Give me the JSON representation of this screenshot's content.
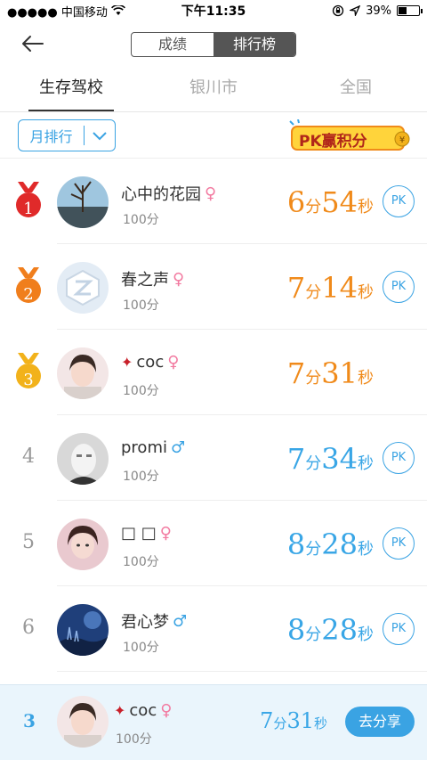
{
  "status_bar": {
    "carrier": "●●●●● 中国移动",
    "time": "下午11:35",
    "battery": "39%"
  },
  "header": {
    "segments": [
      "成绩",
      "排行榜"
    ],
    "active_segment": "排行榜"
  },
  "tabs": [
    "生存驾校",
    "银川市",
    "全国"
  ],
  "filter": {
    "label": "月排行"
  },
  "banner": {
    "text": "PK赢积分"
  },
  "rows": [
    {
      "rank": "1",
      "name": "心中的花园",
      "gender": "♀",
      "score": "100分",
      "min": "6",
      "sec": "54",
      "pk": "PK"
    },
    {
      "rank": "2",
      "name": "春之声",
      "gender": "♀",
      "score": "100分",
      "min": "7",
      "sec": "14",
      "pk": "PK"
    },
    {
      "rank": "3",
      "name": "coc",
      "gender": "♀",
      "score": "100分",
      "min": "7",
      "sec": "31",
      "pk": ""
    },
    {
      "rank": "4",
      "name": "promi",
      "gender": "♂",
      "score": "100分",
      "min": "7",
      "sec": "34",
      "pk": "PK"
    },
    {
      "rank": "5",
      "name": "□ □",
      "gender": "♀",
      "score": "100分",
      "min": "8",
      "sec": "28",
      "pk": "PK"
    },
    {
      "rank": "6",
      "name": "君心梦",
      "gender": "♂",
      "score": "100分",
      "min": "8",
      "sec": "28",
      "pk": "PK"
    }
  ],
  "units": {
    "min": "分",
    "sec": "秒"
  },
  "me": {
    "rank": "3",
    "name": "coc",
    "gender": "♀",
    "score": "100分",
    "min": "7",
    "sec": "31",
    "share": "去分享"
  },
  "colors": {
    "accent": "#3aa3e3",
    "top3": "#f08a1a",
    "gold": "#f2b21b",
    "silver": "#f07e1c",
    "red": "#e02a2a"
  }
}
